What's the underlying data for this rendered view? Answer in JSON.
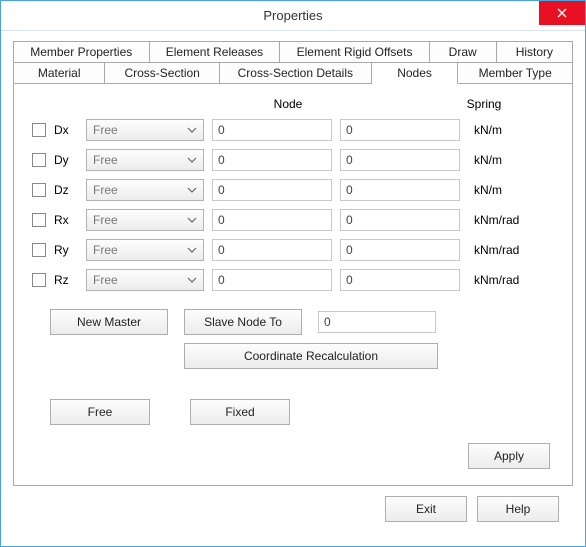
{
  "window": {
    "title": "Properties"
  },
  "tabs": {
    "row1": [
      "Member Properties",
      "Element Releases",
      "Element Rigid Offsets",
      "Draw",
      "History"
    ],
    "row2": [
      "Material",
      "Cross-Section",
      "Cross-Section Details",
      "Nodes",
      "Member Type"
    ],
    "active": "Nodes"
  },
  "headers": {
    "node": "Node",
    "spring": "Spring"
  },
  "dofs": [
    {
      "label": "Dx",
      "combo": "Free",
      "node": "0",
      "spring": "0",
      "unit": "kN/m"
    },
    {
      "label": "Dy",
      "combo": "Free",
      "node": "0",
      "spring": "0",
      "unit": "kN/m"
    },
    {
      "label": "Dz",
      "combo": "Free",
      "node": "0",
      "spring": "0",
      "unit": "kN/m"
    },
    {
      "label": "Rx",
      "combo": "Free",
      "node": "0",
      "spring": "0",
      "unit": "kNm/rad"
    },
    {
      "label": "Ry",
      "combo": "Free",
      "node": "0",
      "spring": "0",
      "unit": "kNm/rad"
    },
    {
      "label": "Rz",
      "combo": "Free",
      "node": "0",
      "spring": "0",
      "unit": "kNm/rad"
    }
  ],
  "buttons": {
    "new_master": "New Master",
    "slave_to": "Slave Node To",
    "slave_val": "0",
    "coord": "Coordinate Recalculation",
    "free": "Free",
    "fixed": "Fixed",
    "apply": "Apply",
    "exit": "Exit",
    "help": "Help"
  }
}
